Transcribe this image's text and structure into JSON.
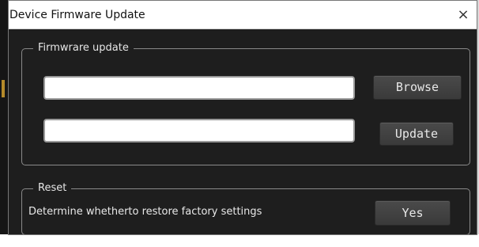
{
  "dialog": {
    "title": "Device Firmware Update",
    "close_glyph": "×"
  },
  "firmware_group": {
    "legend": "Firmwrare update",
    "path_field": {
      "value": "",
      "placeholder": ""
    },
    "status_field": {
      "value": "",
      "placeholder": ""
    },
    "browse_label": "Browse",
    "update_label": "Update"
  },
  "reset_group": {
    "legend": "Reset",
    "description": "Determine whetherto restore factory settings",
    "yes_label": "Yes"
  },
  "colors": {
    "dialog_background": "#1e1e1e",
    "titlebar_background": "#ffffff",
    "button_background": "#424242",
    "group_border": "#8a8a8a"
  },
  "icons": {
    "close": "close-icon"
  }
}
